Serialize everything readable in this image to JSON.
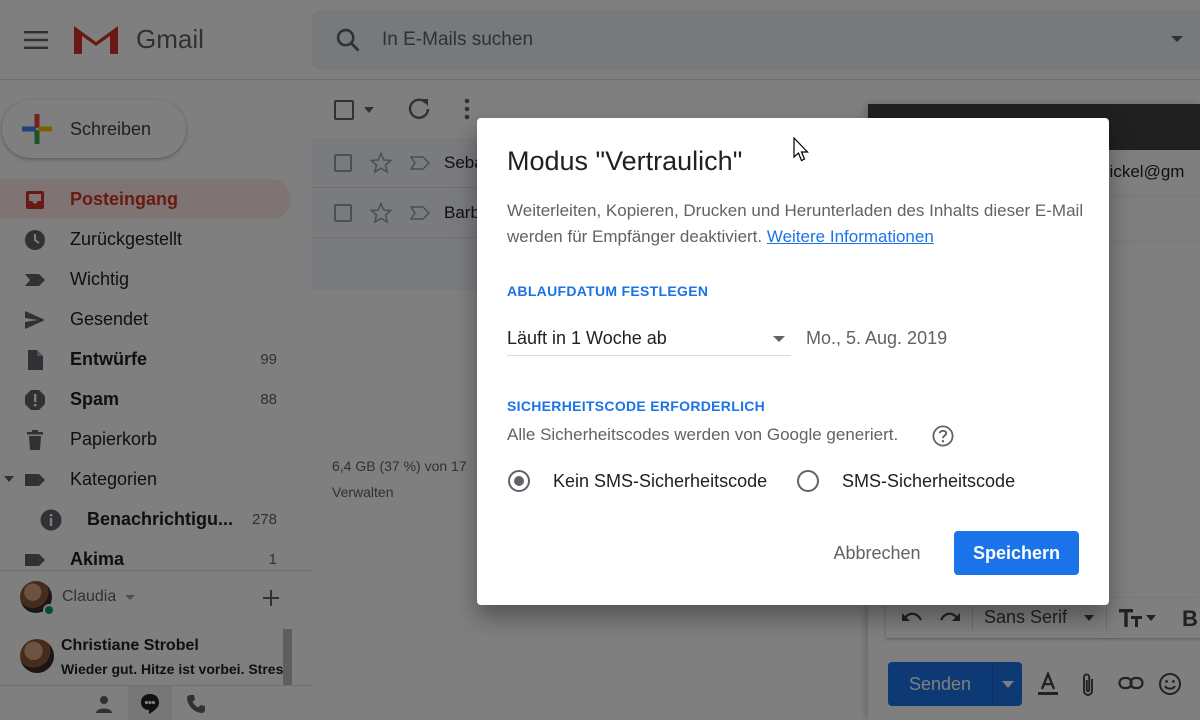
{
  "header": {
    "app_name": "Gmail",
    "search_placeholder": "In E-Mails suchen"
  },
  "sidebar": {
    "compose_label": "Schreiben",
    "items": [
      {
        "label": "Posteingang",
        "count": "",
        "icon": "inbox-icon",
        "active": true
      },
      {
        "label": "Zurückgestellt",
        "count": "",
        "icon": "clock-icon"
      },
      {
        "label": "Wichtig",
        "count": "",
        "icon": "label-important-icon"
      },
      {
        "label": "Gesendet",
        "count": "",
        "icon": "send-icon"
      },
      {
        "label": "Entwürfe",
        "count": "99",
        "icon": "draft-icon",
        "bold": true
      },
      {
        "label": "Spam",
        "count": "88",
        "icon": "spam-icon",
        "bold": true
      },
      {
        "label": "Papierkorb",
        "count": "",
        "icon": "trash-icon"
      },
      {
        "label": "Kategorien",
        "count": "",
        "icon": "label-icon"
      },
      {
        "label": "Benachrichtigu...",
        "count": "278",
        "icon": "info-icon",
        "bold": true
      },
      {
        "label": "Akima",
        "count": "1",
        "icon": "label-icon",
        "bold": true
      }
    ]
  },
  "hangouts": {
    "user_name": "Claudia",
    "chat_name": "Christiane Strobel",
    "chat_message": "Wieder gut. Hitze ist vorbei. Stress"
  },
  "mail_list": {
    "rows": [
      {
        "sender": "Seba"
      },
      {
        "sender": "Barb"
      }
    ],
    "storage_text": "6,4 GB (37 %) von 17",
    "manage_label": "Verwalten"
  },
  "compose_window": {
    "to_partial": "a.frickel@gm",
    "font_name": "Sans Serif",
    "send_label": "Senden"
  },
  "dialog": {
    "title": "Modus \"Vertraulich\"",
    "description": "Weiterleiten, Kopieren, Drucken und Herunterladen des Inhalts dieser E-Mail werden für Empfänger deaktiviert.",
    "link_label": "Weitere Informationen",
    "expiry_section_title": "ABLAUFDATUM FESTLEGEN",
    "expiry_value": "Läuft in 1 Woche ab",
    "expiry_date": "Mo., 5. Aug. 2019",
    "code_section_title": "SICHERHEITSCODE ERFORDERLICH",
    "code_note": "Alle Sicherheitscodes werden von Google generiert.",
    "radio_options": [
      {
        "label": "Kein SMS-Sicherheitscode",
        "checked": true
      },
      {
        "label": "SMS-Sicherheitscode",
        "checked": false
      }
    ],
    "cancel_label": "Abbrechen",
    "save_label": "Speichern"
  },
  "colors": {
    "accent_blue": "#1a73e8",
    "gmail_red": "#d93025",
    "overlay": "rgba(0,0,0,0.5)"
  }
}
